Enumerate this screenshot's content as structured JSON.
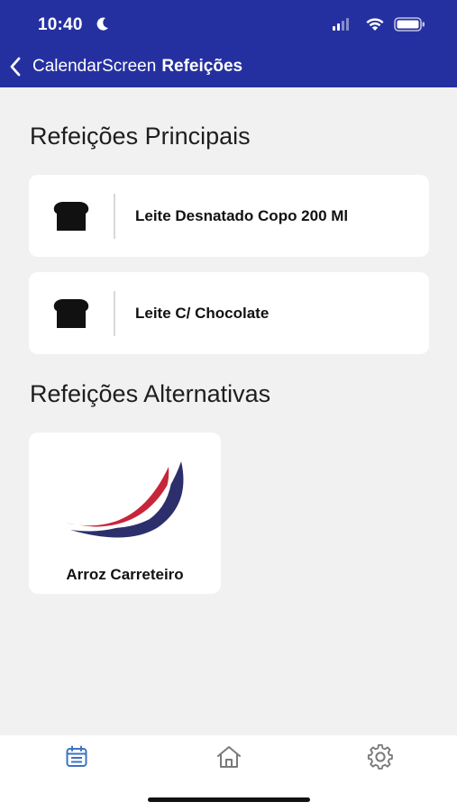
{
  "status_bar": {
    "time": "10:40"
  },
  "nav": {
    "back_label": "CalendarScreen",
    "title": "Refeições"
  },
  "sections": {
    "main_title": "Refeições Principais",
    "alt_title": "Refeições Alternativas"
  },
  "main_meals": [
    {
      "label": "Leite Desnatado Copo 200 Ml",
      "icon": "bread-icon"
    },
    {
      "label": "Leite C/ Chocolate",
      "icon": "bread-icon"
    }
  ],
  "alt_meals": [
    {
      "label": "Arroz Carreteiro",
      "icon": "swoosh-logo"
    }
  ],
  "tabs": [
    {
      "name": "calendar",
      "icon": "calendar-icon",
      "active": true
    },
    {
      "name": "home",
      "icon": "home-icon",
      "active": false
    },
    {
      "name": "settings",
      "icon": "gear-icon",
      "active": false
    }
  ],
  "colors": {
    "header": "#2530a0",
    "background": "#f1f1f1",
    "tab_active": "#3b73c4",
    "tab_inactive": "#7a7a7a",
    "logo_red": "#c8253a",
    "logo_navy": "#2c2f6b"
  }
}
